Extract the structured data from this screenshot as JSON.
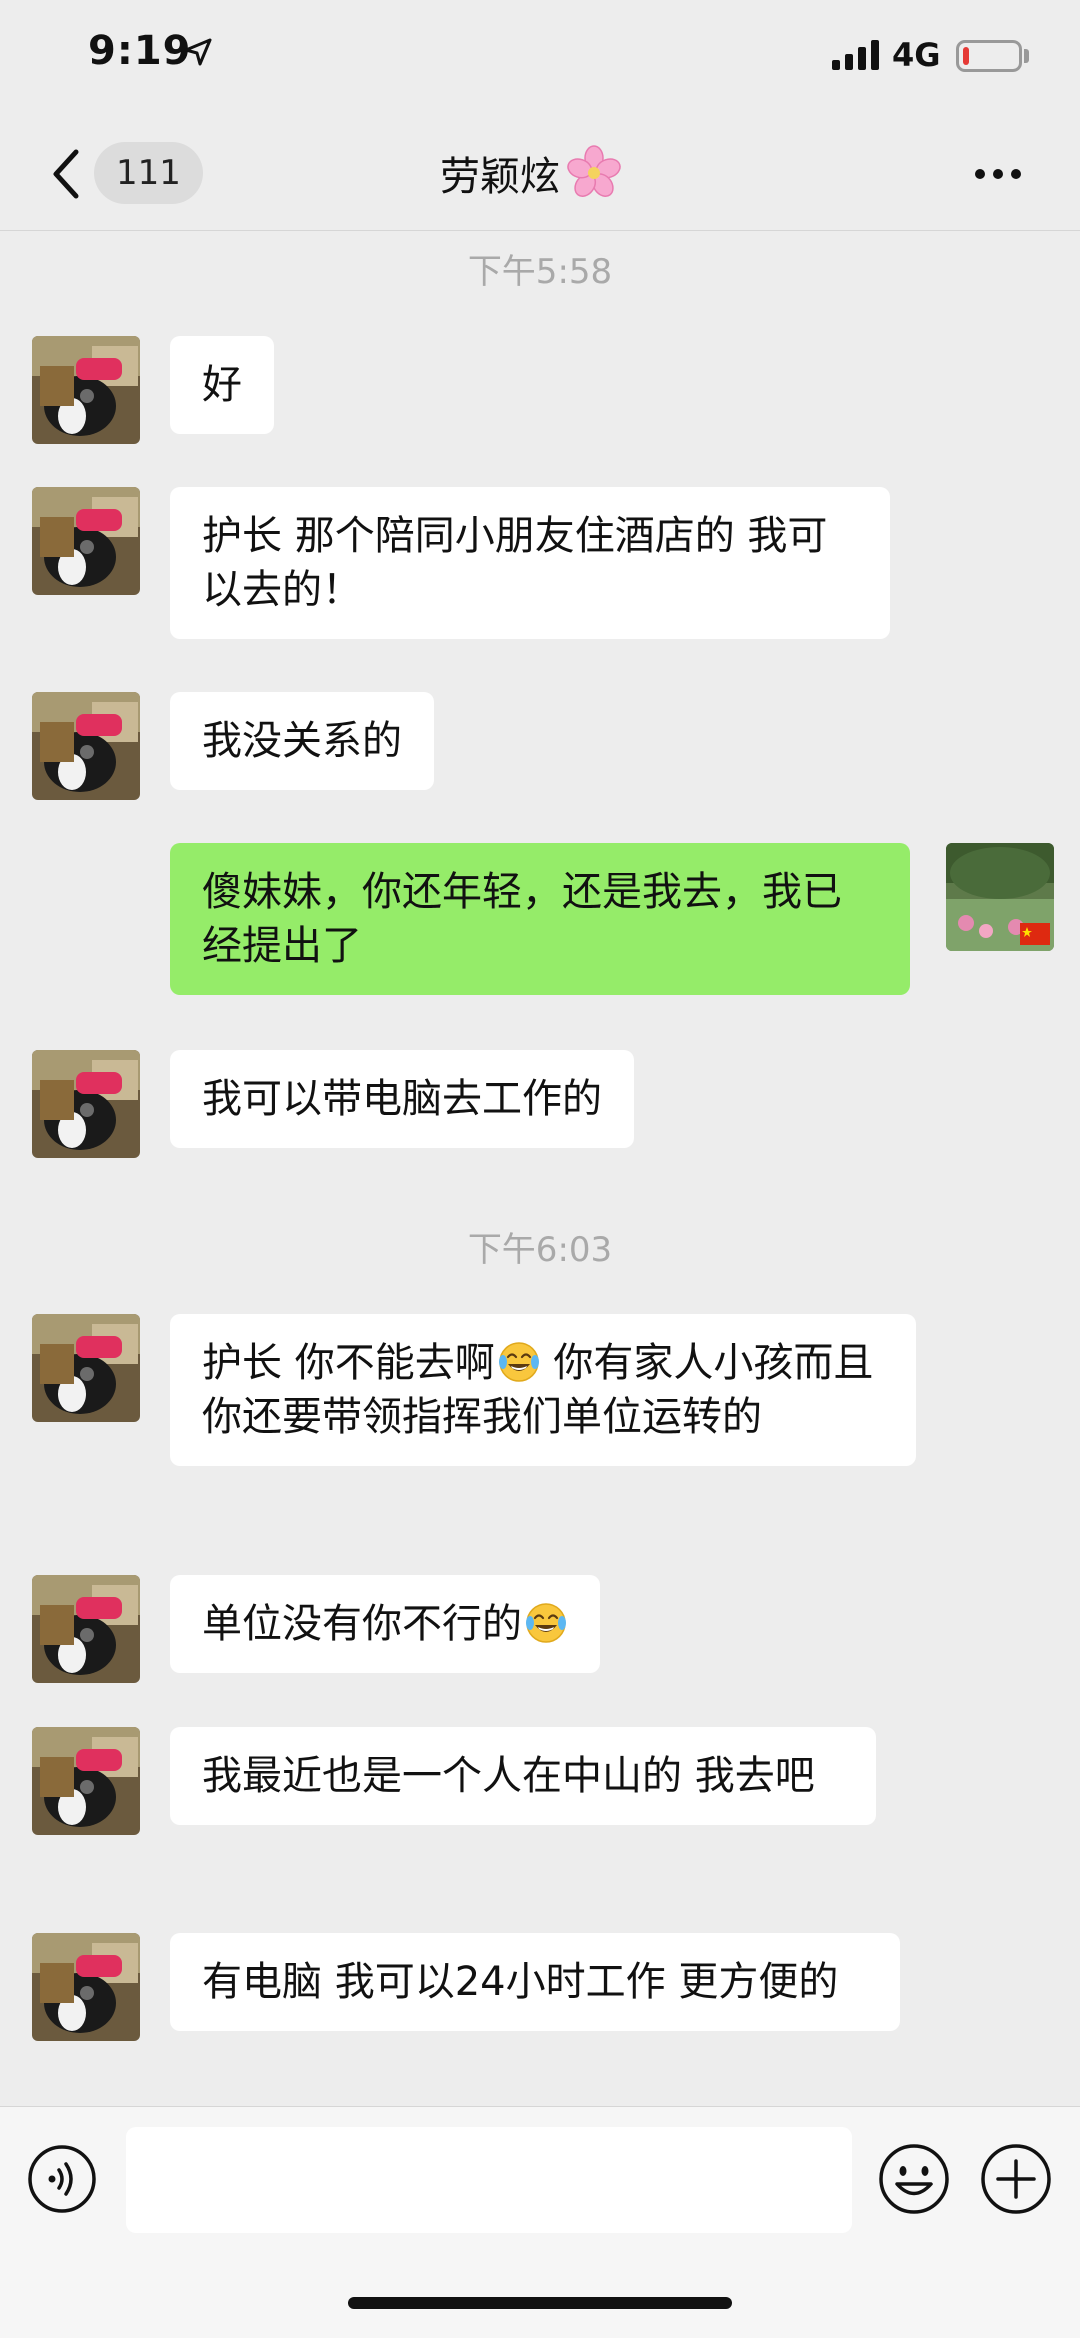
{
  "status_bar": {
    "time": "9:19",
    "network": "4G",
    "battery_level": 0.12,
    "battery_color": "#e53935"
  },
  "nav": {
    "back_icon": "chevron-left-icon",
    "unread_count": "111",
    "title": "劳颖炫",
    "title_icon": "cherry-blossom-icon",
    "more_icon": "more-dots-icon"
  },
  "timestamps": [
    "下午5:58",
    "下午6:03"
  ],
  "messages": [
    {
      "sender": "other",
      "text": "好"
    },
    {
      "sender": "other",
      "text": "护长 那个陪同小朋友住酒店的 我可以去的！"
    },
    {
      "sender": "other",
      "text": "我没关系的"
    },
    {
      "sender": "me",
      "text": "傻妹妹，你还年轻，还是我去，我已经提出了"
    },
    {
      "sender": "other",
      "text": "我可以带电脑去工作的"
    },
    {
      "sender": "other",
      "text_before": "护长 你不能去啊",
      "text_after": " 你有家人小孩而且你还要带领指挥我们单位运转的",
      "emoji": "tears-of-joy-icon"
    },
    {
      "sender": "other",
      "text_before": "单位没有你不行的",
      "emoji": "tears-of-joy-icon"
    },
    {
      "sender": "other",
      "text": "我最近也是一个人在中山的 我去吧"
    },
    {
      "sender": "other",
      "text": "有电脑 我可以24小时工作 更方便的"
    }
  ],
  "input_bar": {
    "voice_icon": "voice-icon",
    "input_value": "",
    "emoji_icon": "smiley-icon",
    "plus_icon": "plus-circle-icon"
  },
  "colors": {
    "background": "#ededed",
    "my_bubble": "#95ec69",
    "other_bubble": "#ffffff",
    "timestamp": "#a9a9a9"
  }
}
